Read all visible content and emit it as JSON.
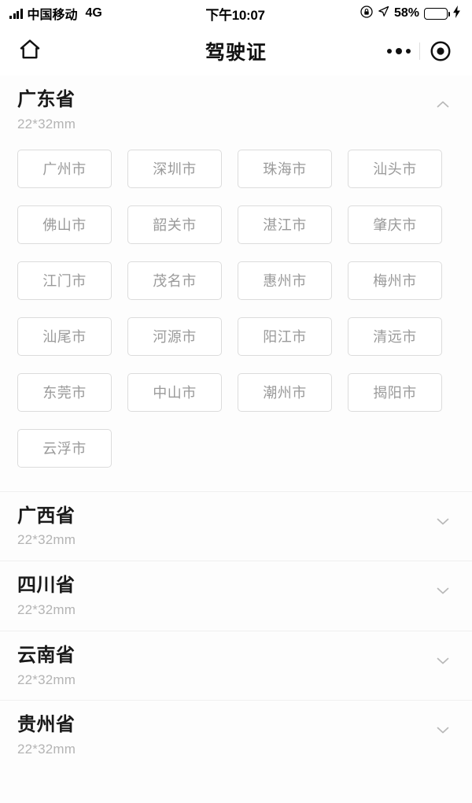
{
  "status_bar": {
    "carrier": "中国移动",
    "network": "4G",
    "time": "下午10:07",
    "battery_percent": "58%",
    "battery_level": 58,
    "icons": {
      "signal": "signal-bars-icon",
      "lock": "lock-rotation-icon",
      "location": "location-arrow-icon",
      "battery": "battery-icon",
      "charging": "lightning-bolt-icon"
    }
  },
  "nav": {
    "title": "驾驶证",
    "home_icon": "home-icon",
    "more_icon": "more-dots-icon",
    "target_icon": "target-icon"
  },
  "colors": {
    "battery_green": "#34c759",
    "chip_border": "#dcdcdc",
    "chip_text": "#9a9a9a",
    "heading_text": "#1a1a1a",
    "subtitle_text": "#b4b4b4",
    "page_background": "#fdfdfd",
    "divider": "#f0f0f0"
  },
  "provinces": [
    {
      "name": "广东省",
      "size": "22*32mm",
      "expanded": true,
      "chevron": "chevron-up-icon",
      "cities": [
        "广州市",
        "深圳市",
        "珠海市",
        "汕头市",
        "佛山市",
        "韶关市",
        "湛江市",
        "肇庆市",
        "江门市",
        "茂名市",
        "惠州市",
        "梅州市",
        "汕尾市",
        "河源市",
        "阳江市",
        "清远市",
        "东莞市",
        "中山市",
        "潮州市",
        "揭阳市",
        "云浮市"
      ]
    },
    {
      "name": "广西省",
      "size": "22*32mm",
      "expanded": false,
      "chevron": "chevron-down-icon",
      "cities": []
    },
    {
      "name": "四川省",
      "size": "22*32mm",
      "expanded": false,
      "chevron": "chevron-down-icon",
      "cities": []
    },
    {
      "name": "云南省",
      "size": "22*32mm",
      "expanded": false,
      "chevron": "chevron-down-icon",
      "cities": []
    },
    {
      "name": "贵州省",
      "size": "22*32mm",
      "expanded": false,
      "chevron": "chevron-down-icon",
      "cities": []
    }
  ]
}
